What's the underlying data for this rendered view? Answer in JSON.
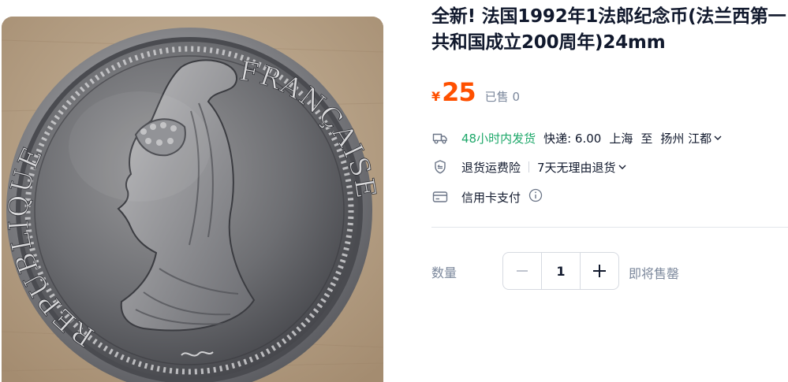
{
  "product": {
    "title": "全新! 法国1992年1法郎纪念币(法兰西第一共和国成立200周年)24mm",
    "image_alt": "法国1992年1法郎纪念币",
    "coin_text": {
      "left_arc": "REPUBLIQUE",
      "right_arc": "FRANÇAISE"
    }
  },
  "price": {
    "currency_symbol": "¥",
    "value": "25",
    "sold_label": "已售 0"
  },
  "services": {
    "shipping": {
      "icon": "truck-icon",
      "promise": "48小时内发货",
      "fee": "快递: 6.00",
      "origin": "上海",
      "to": "至",
      "destination": "扬州 江都"
    },
    "returns": {
      "icon": "shield-return-icon",
      "insurance": "退货运费险",
      "policy": "7天无理由退货"
    },
    "payment": {
      "icon": "credit-card-icon",
      "label": "信用卡支付"
    }
  },
  "quantity": {
    "label": "数量",
    "value": "1",
    "stock_status": "即将售罄"
  },
  "colors": {
    "price": "#ff5000",
    "green": "#1ea86a",
    "muted": "#7c889c"
  }
}
